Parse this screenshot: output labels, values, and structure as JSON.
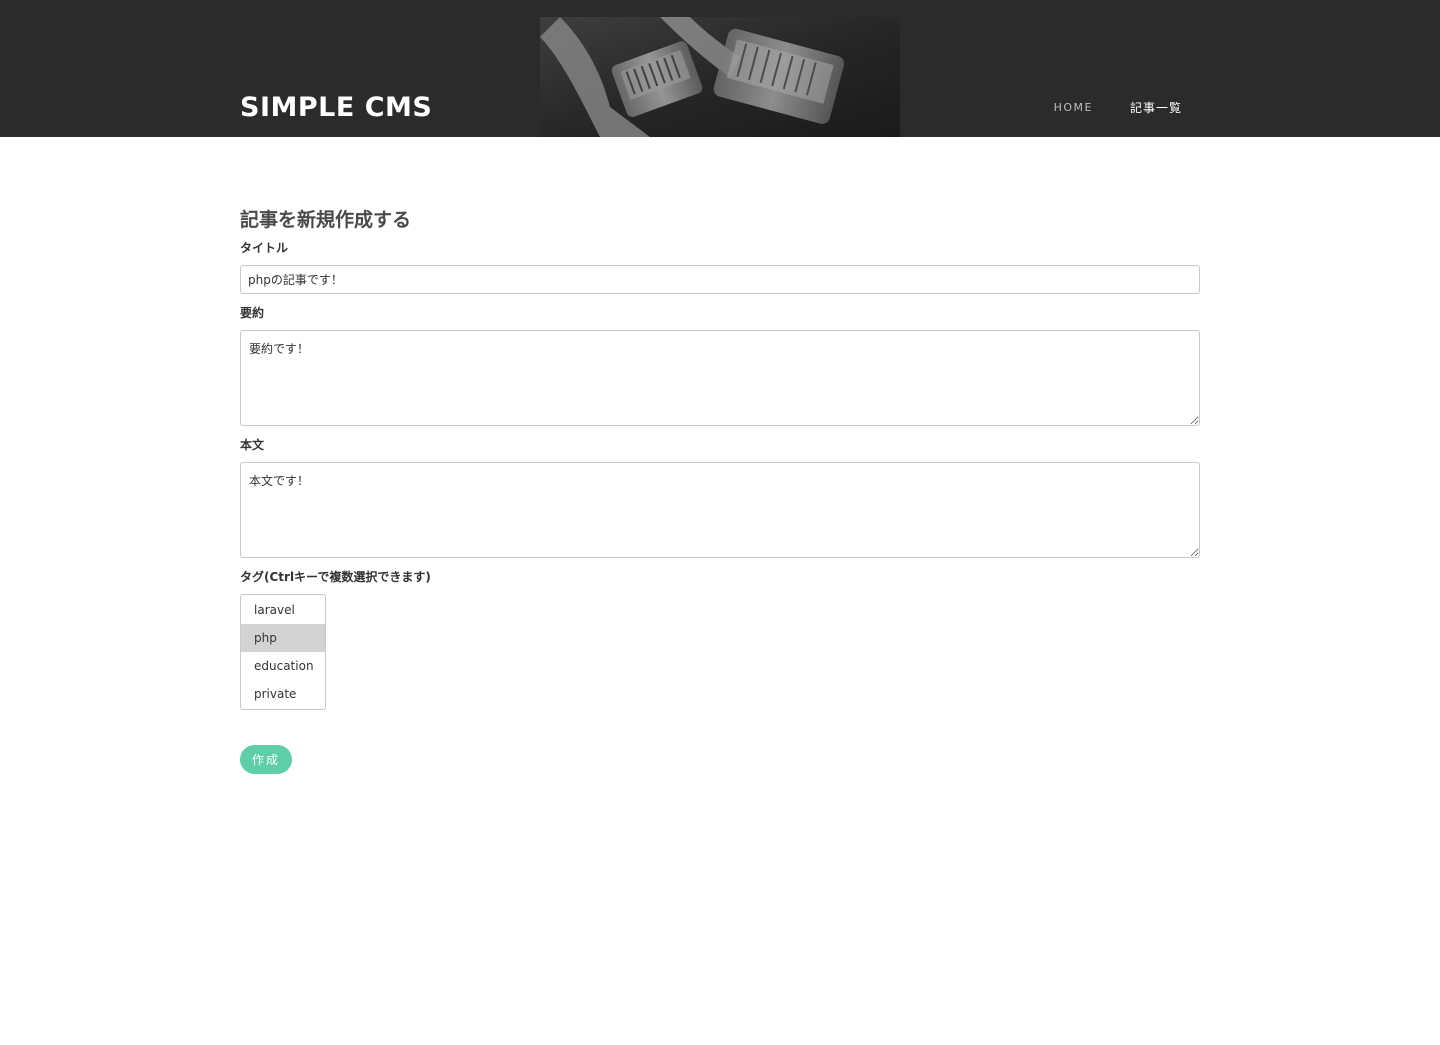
{
  "header": {
    "brand": "SIMPLE CMS",
    "nav": [
      {
        "label": "HOME"
      },
      {
        "label": "記事一覧"
      }
    ]
  },
  "form": {
    "page_title": "記事を新規作成する",
    "title_label": "タイトル",
    "title_value": "phpの記事です！",
    "summary_label": "要約",
    "summary_value": "要約です！",
    "body_label": "本文",
    "body_value": "本文です！",
    "tags_label": "タグ(Ctrlキーで複数選択できます)",
    "tags": [
      {
        "label": "laravel",
        "selected": false
      },
      {
        "label": "php",
        "selected": true
      },
      {
        "label": "education",
        "selected": false
      },
      {
        "label": "private",
        "selected": false
      }
    ],
    "submit_label": "作成"
  },
  "colors": {
    "header_bg": "#2b2b2b",
    "accent": "#5fcfa8",
    "selected_option_bg": "#d3d3d3"
  }
}
